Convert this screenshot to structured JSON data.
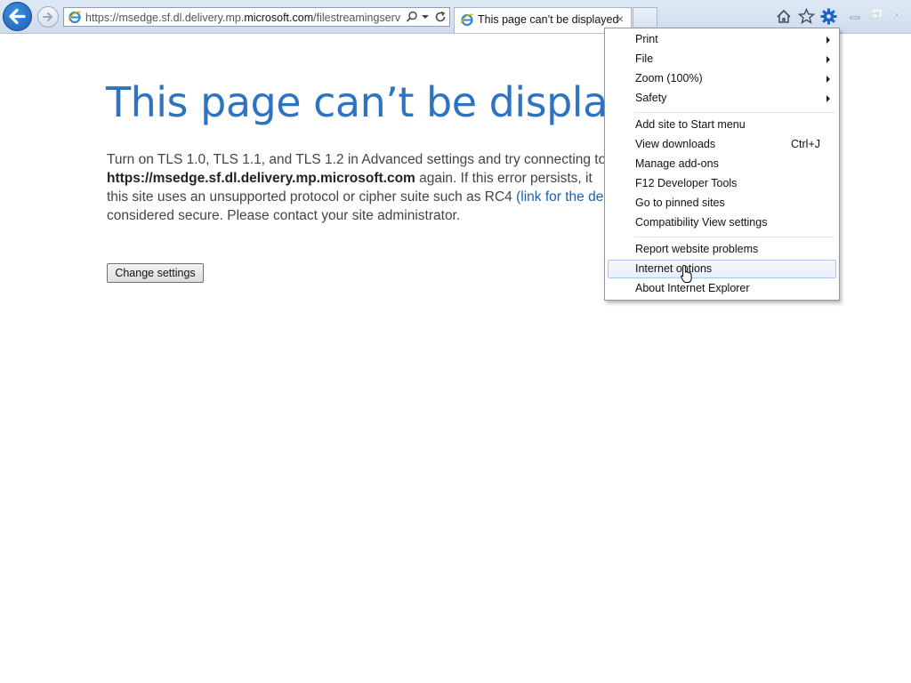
{
  "browser": {
    "address_bar": {
      "url_prefix": "https://msedge.sf.dl.delivery.mp.",
      "url_host": "microsoft.com",
      "url_suffix": "/filestreamingservic"
    },
    "tab": {
      "title": "This page can’t be displayed",
      "close": "×"
    },
    "icons": [
      "back-arrow",
      "forward-arrow",
      "ie-logo",
      "search",
      "dropdown",
      "refresh",
      "home",
      "favorites-star",
      "gear",
      "minimize",
      "restore",
      "close"
    ]
  },
  "page": {
    "heading": "This page can’t be displayed",
    "body": {
      "line1": "Turn on TLS 1.0, TLS 1.1, and TLS 1.2 in Advanced settings and try connecting to",
      "line2_bold": "https://msedge.sf.dl.delivery.mp.microsoft.com",
      "line2_rest": " again. If this error persists, it",
      "line3_pre": "this site uses an unsupported protocol or cipher suite such as RC4 ",
      "line3_link": "(link for the de",
      "line4": "considered secure. Please contact your site administrator."
    },
    "change_settings_label": "Change settings"
  },
  "tools_menu": {
    "items": [
      {
        "label": "Print",
        "submenu": true
      },
      {
        "label": "File",
        "submenu": true
      },
      {
        "label": "Zoom (100%)",
        "submenu": true
      },
      {
        "label": "Safety",
        "submenu": true
      },
      {
        "label": "Add site to Start menu"
      },
      {
        "label": "View downloads",
        "shortcut": "Ctrl+J"
      },
      {
        "label": "Manage add-ons"
      },
      {
        "label": "F12 Developer Tools"
      },
      {
        "label": "Go to pinned sites"
      },
      {
        "label": "Compatibility View settings"
      },
      {
        "label": "Report website problems"
      },
      {
        "label": "Internet options",
        "highlighted": true
      },
      {
        "label": "About Internet Explorer"
      }
    ]
  },
  "colors": {
    "heading": "#2e72c2",
    "link": "#1f5fa8",
    "chrome_bg": "#dfe9f5",
    "menu_highlight_border": "#a9c6ea"
  }
}
